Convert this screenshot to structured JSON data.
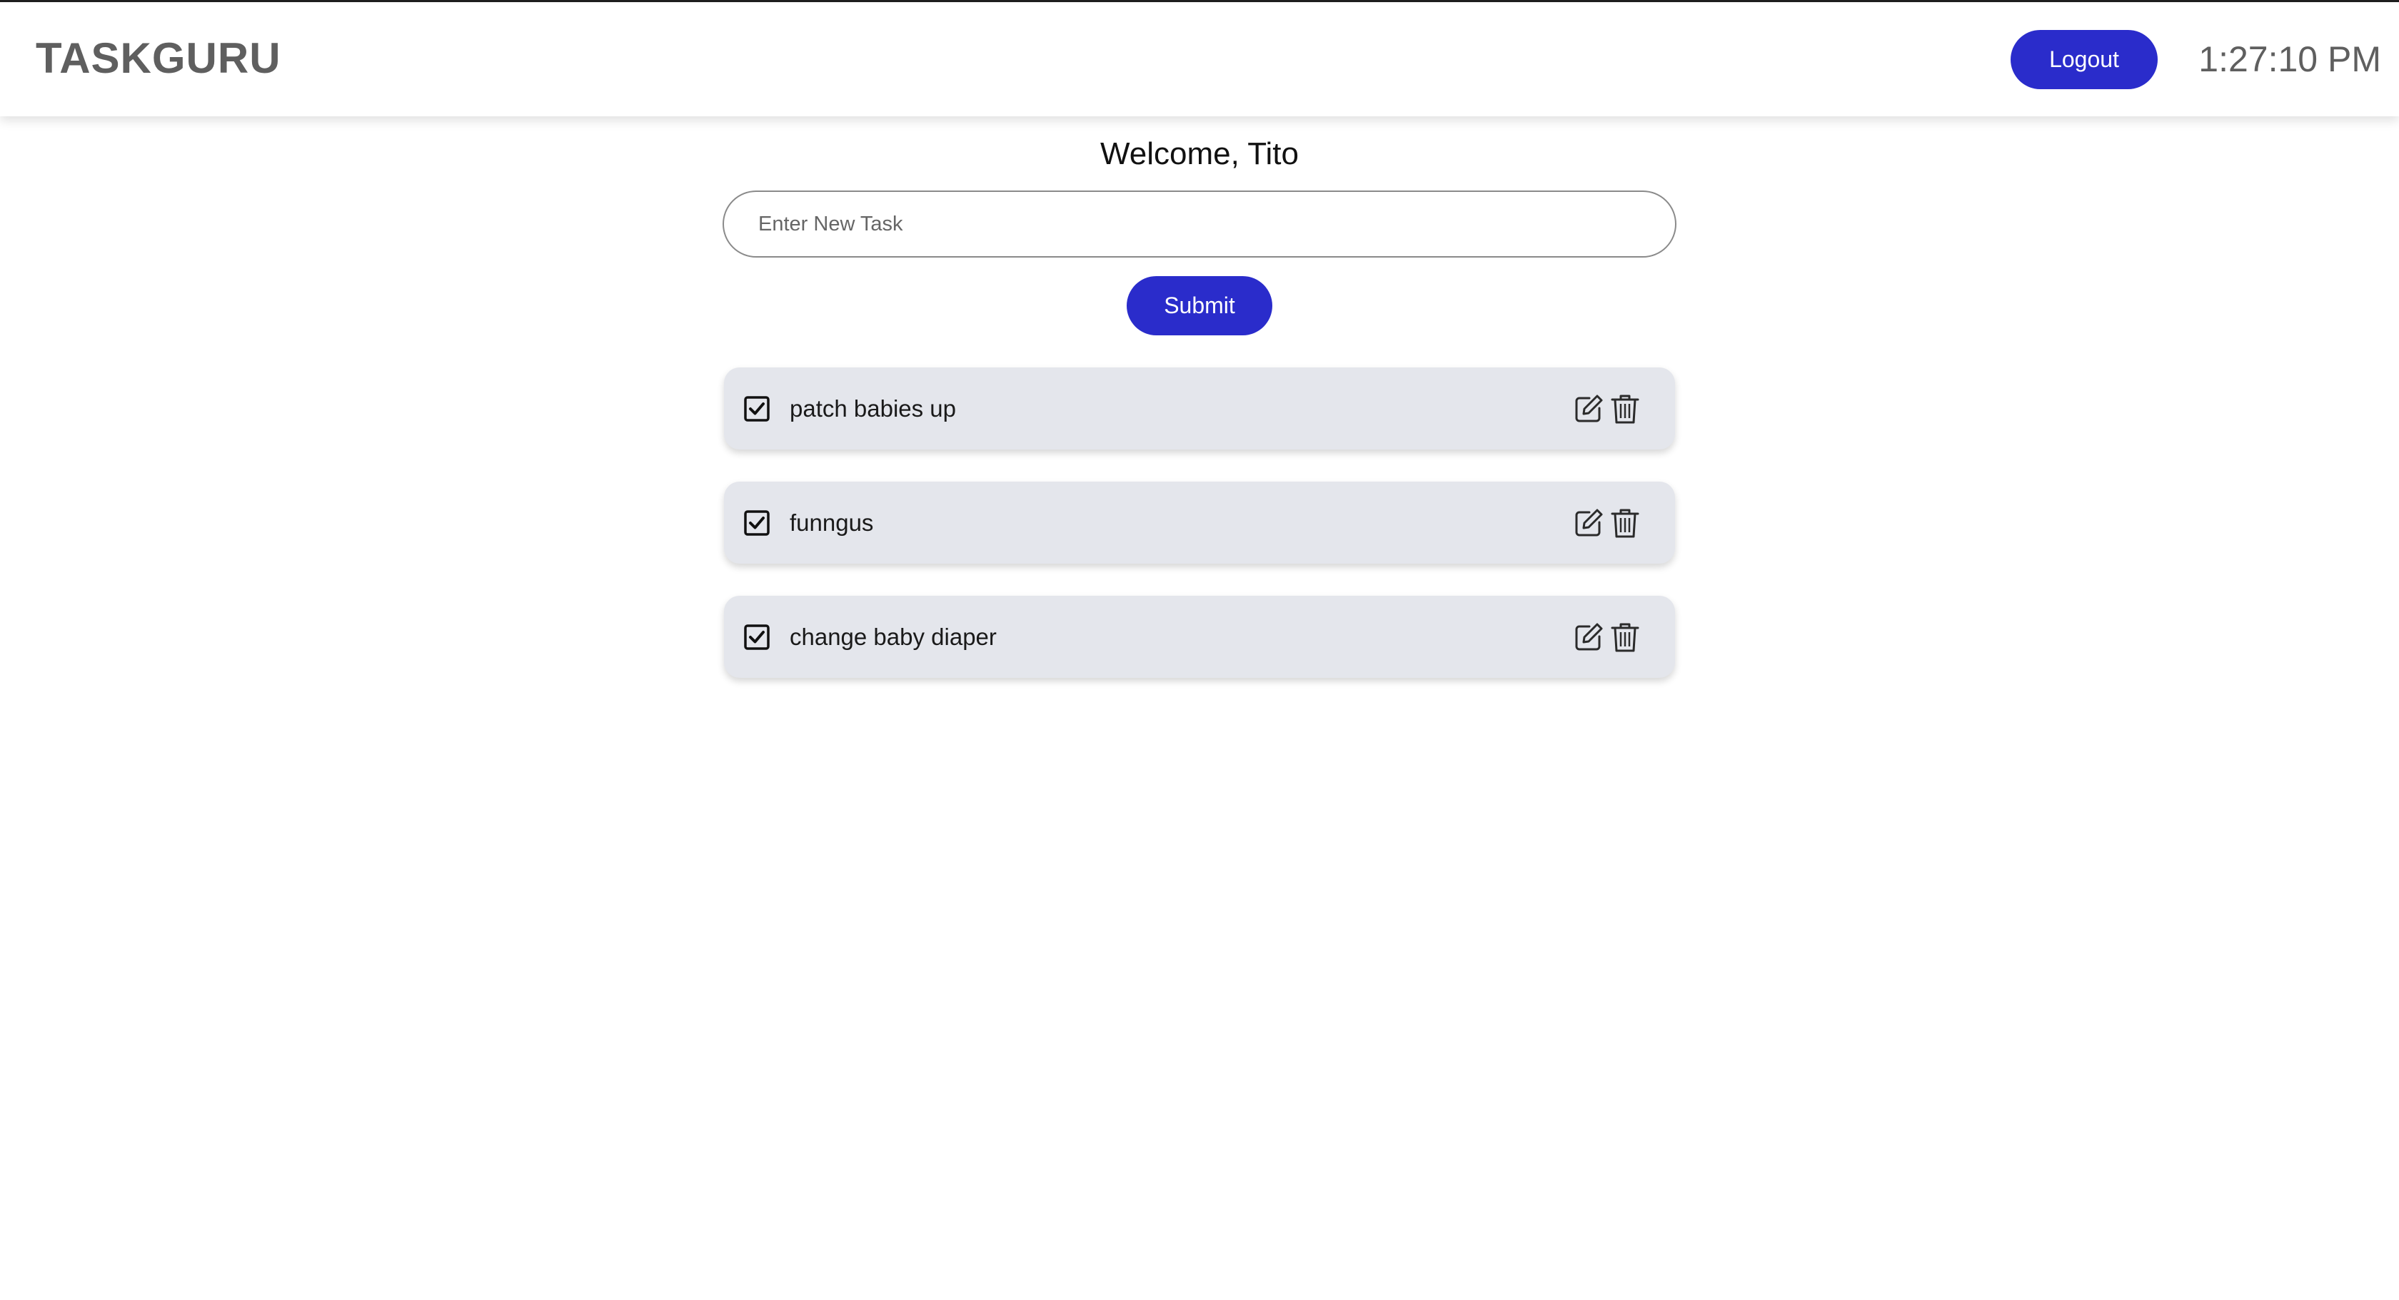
{
  "header": {
    "brand": "TASKGURU",
    "logout_label": "Logout",
    "clock": "1:27:10 PM"
  },
  "main": {
    "welcome": "Welcome, Tito",
    "task_input": {
      "placeholder": "Enter New Task",
      "value": ""
    },
    "submit_label": "Submit"
  },
  "tasks": [
    {
      "text": "patch babies up",
      "checked": true
    },
    {
      "text": "funngus",
      "checked": true
    },
    {
      "text": "change baby diaper",
      "checked": true
    }
  ],
  "icons": {
    "checkbox": "checkbox-checked-icon",
    "edit": "edit-icon",
    "delete": "trash-icon"
  },
  "colors": {
    "accent": "#2a2ccb",
    "task_background": "#e4e6ec",
    "brand_text": "#5f5f5f"
  }
}
